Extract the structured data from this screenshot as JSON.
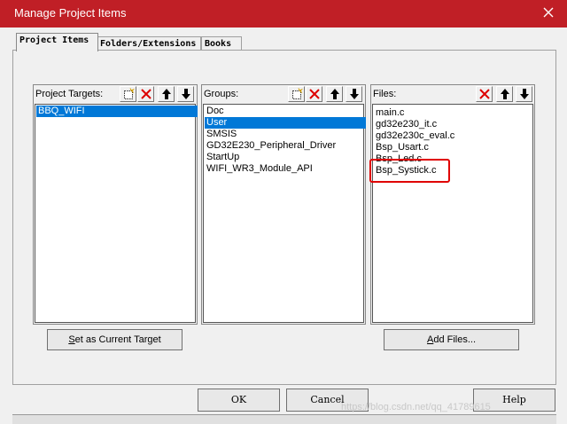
{
  "window": {
    "title": "Manage Project Items",
    "accent": "#c01f26",
    "close_icon": "close-icon"
  },
  "tabs": [
    {
      "label": "Project Items",
      "active": true
    },
    {
      "label": "Folders/Extensions",
      "active": false
    },
    {
      "label": "Books",
      "active": false
    }
  ],
  "targets": {
    "label": "Project Targets:",
    "items": [
      "BBQ_WIFI"
    ],
    "selected": "BBQ_WIFI"
  },
  "groups": {
    "label": "Groups:",
    "items": [
      "Doc",
      "User",
      "SMSIS",
      "GD32E230_Peripheral_Driver",
      "StartUp",
      "WIFI_WR3_Module_API"
    ],
    "selected": "User"
  },
  "files": {
    "label": "Files:",
    "items": [
      "main.c",
      "gd32e230_it.c",
      "gd32e230c_eval.c",
      "Bsp_Usart.c",
      "Bsp_Led.c",
      "Bsp_Systick.c"
    ],
    "highlighted": "Bsp_Systick.c"
  },
  "buttons": {
    "set_target_pre": "S",
    "set_target_rest": "et as Current Target",
    "add_files_pre": "A",
    "add_files_rest": "dd Files...",
    "ok": "OK",
    "cancel": "Cancel",
    "help": "Help"
  },
  "watermark": "https://blog.csdn.net/qq_41789615"
}
